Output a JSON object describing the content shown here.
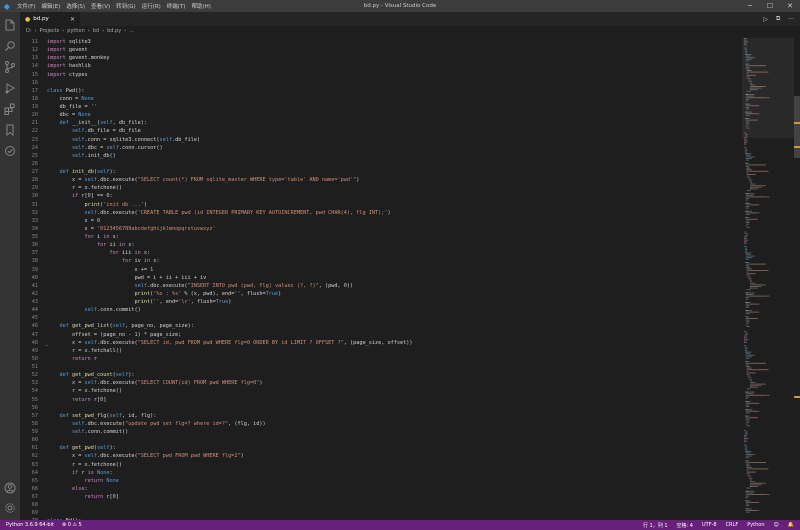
{
  "window": {
    "title": "bd.py - Visual Studio Code",
    "menu": [
      "文件(F)",
      "编辑(E)",
      "选择(S)",
      "查看(V)",
      "转到(G)",
      "运行(R)",
      "终端(T)",
      "帮助(H)"
    ],
    "controls": [
      "─",
      "☐",
      "✕"
    ]
  },
  "activity": [
    "explorer-icon",
    "search-icon",
    "source-control-icon",
    "run-debug-icon",
    "extensions-icon",
    "bookmark-icon",
    "testing-icon",
    "remote-icon",
    "account-icon",
    "gear-icon"
  ],
  "tab": {
    "label": "bd.py",
    "close": "✕"
  },
  "tab_actions": [
    "▷",
    "⧉",
    "···"
  ],
  "breadcrumb": [
    "D:",
    "Projects",
    "python",
    "bd",
    "bd.py",
    "..."
  ],
  "editor": {
    "marker_line": 48,
    "lines": [
      {
        "n": 11,
        "t": [
          [
            "kwc",
            "import"
          ],
          [
            "txt",
            " sqlite3"
          ]
        ]
      },
      {
        "n": 12,
        "t": [
          [
            "kwc",
            "import"
          ],
          [
            "txt",
            " gevent"
          ]
        ]
      },
      {
        "n": 13,
        "t": [
          [
            "kwc",
            "import"
          ],
          [
            "txt",
            " gevent.monkey"
          ]
        ]
      },
      {
        "n": 14,
        "t": [
          [
            "kwc",
            "import"
          ],
          [
            "txt",
            " hashlib"
          ]
        ]
      },
      {
        "n": 15,
        "t": [
          [
            "kwc",
            "import"
          ],
          [
            "txt",
            " ctypes"
          ]
        ]
      },
      {
        "n": 16,
        "t": []
      },
      {
        "n": 17,
        "t": [
          [
            "kw",
            "class"
          ],
          [
            "txt",
            " Pwd():"
          ]
        ]
      },
      {
        "n": 18,
        "t": [
          [
            "txt",
            "    conn = "
          ],
          [
            "kw",
            "None"
          ]
        ]
      },
      {
        "n": 19,
        "t": [
          [
            "txt",
            "    db_file = "
          ],
          [
            "str",
            "''"
          ]
        ]
      },
      {
        "n": 20,
        "t": [
          [
            "txt",
            "    dbc = "
          ],
          [
            "kw",
            "None"
          ]
        ]
      },
      {
        "n": 21,
        "t": [
          [
            "kw",
            "    def"
          ],
          [
            "fn",
            " __init__"
          ],
          [
            "txt",
            "("
          ],
          [
            "self",
            "self"
          ],
          [
            "txt",
            ", db_file):"
          ]
        ]
      },
      {
        "n": 22,
        "t": [
          [
            "self",
            "        self"
          ],
          [
            "txt",
            ".db_file = db_file"
          ]
        ]
      },
      {
        "n": 23,
        "t": [
          [
            "self",
            "        self"
          ],
          [
            "txt",
            ".conn = sqlite3.connect("
          ],
          [
            "self",
            "self"
          ],
          [
            "txt",
            ".db_file)"
          ]
        ]
      },
      {
        "n": 24,
        "t": [
          [
            "self",
            "        self"
          ],
          [
            "txt",
            ".dbc = "
          ],
          [
            "self",
            "self"
          ],
          [
            "txt",
            ".conn.cursor()"
          ]
        ]
      },
      {
        "n": 25,
        "t": [
          [
            "self",
            "        self"
          ],
          [
            "txt",
            ".init_db()"
          ]
        ]
      },
      {
        "n": 26,
        "t": []
      },
      {
        "n": 27,
        "t": [
          [
            "kw",
            "    def"
          ],
          [
            "fn",
            " init_db"
          ],
          [
            "txt",
            "("
          ],
          [
            "self",
            "self"
          ],
          [
            "txt",
            "):"
          ]
        ]
      },
      {
        "n": 28,
        "t": [
          [
            "txt",
            "        x = "
          ],
          [
            "self",
            "self"
          ],
          [
            "txt",
            ".dbc.execute("
          ],
          [
            "str",
            "\"SELECT count(*) FROM sqlite_master WHERE type='table' AND name='pwd'\""
          ],
          [
            "txt",
            ")"
          ]
        ]
      },
      {
        "n": 29,
        "t": [
          [
            "txt",
            "        r = x.fetchone()"
          ]
        ]
      },
      {
        "n": 30,
        "t": [
          [
            "kwc",
            "        if"
          ],
          [
            "txt",
            " r["
          ],
          [
            "num",
            "0"
          ],
          [
            "txt",
            "] == "
          ],
          [
            "num",
            "0"
          ],
          [
            "txt",
            ":"
          ]
        ]
      },
      {
        "n": 31,
        "t": [
          [
            "fn",
            "            print"
          ],
          [
            "txt",
            "("
          ],
          [
            "str",
            "'init db ...'"
          ],
          [
            "txt",
            ")"
          ]
        ]
      },
      {
        "n": 32,
        "t": [
          [
            "self",
            "            self"
          ],
          [
            "txt",
            ".dbc.execute("
          ],
          [
            "str",
            "'CREATE TABLE pwd (id INTEGER PRIMARY KEY AUTOINCREMENT, pwd CHAR(4), flg INT);'"
          ],
          [
            "txt",
            ")"
          ]
        ]
      },
      {
        "n": 33,
        "t": [
          [
            "txt",
            "            x = "
          ],
          [
            "num",
            "0"
          ]
        ]
      },
      {
        "n": 34,
        "t": [
          [
            "txt",
            "            s = "
          ],
          [
            "str",
            "'0123456789abcdefghijklmnopqrstuvwxyz'"
          ]
        ]
      },
      {
        "n": 35,
        "t": [
          [
            "kwc",
            "            for"
          ],
          [
            "txt",
            " i "
          ],
          [
            "kwc",
            "in"
          ],
          [
            "txt",
            " s:"
          ]
        ]
      },
      {
        "n": 36,
        "t": [
          [
            "kwc",
            "                for"
          ],
          [
            "txt",
            " ii "
          ],
          [
            "kwc",
            "in"
          ],
          [
            "txt",
            " s:"
          ]
        ]
      },
      {
        "n": 37,
        "t": [
          [
            "kwc",
            "                    for"
          ],
          [
            "txt",
            " iii "
          ],
          [
            "kwc",
            "in"
          ],
          [
            "txt",
            " s:"
          ]
        ]
      },
      {
        "n": 38,
        "t": [
          [
            "kwc",
            "                        for"
          ],
          [
            "txt",
            " iv "
          ],
          [
            "kwc",
            "in"
          ],
          [
            "txt",
            " s:"
          ]
        ]
      },
      {
        "n": 39,
        "t": [
          [
            "txt",
            "                            x += "
          ],
          [
            "num",
            "1"
          ]
        ]
      },
      {
        "n": 40,
        "t": [
          [
            "txt",
            "                            pwd = i + ii + iii + iv"
          ]
        ]
      },
      {
        "n": 41,
        "t": [
          [
            "self",
            "                            self"
          ],
          [
            "txt",
            ".dbc.execute("
          ],
          [
            "str",
            "\"INSERT INTO pwd (pwd, flg) values (?, ?)\""
          ],
          [
            "txt",
            ", (pwd, "
          ],
          [
            "num",
            "0"
          ],
          [
            "txt",
            "))"
          ]
        ]
      },
      {
        "n": 42,
        "t": [
          [
            "fn",
            "                            print"
          ],
          [
            "txt",
            "("
          ],
          [
            "str",
            "'%s : %s'"
          ],
          [
            "txt",
            " % (x, pwd), end="
          ],
          [
            "str",
            "''"
          ],
          [
            "txt",
            ", flush="
          ],
          [
            "kw",
            "True"
          ],
          [
            "txt",
            ")"
          ]
        ]
      },
      {
        "n": 43,
        "t": [
          [
            "fn",
            "                            print"
          ],
          [
            "txt",
            "("
          ],
          [
            "str",
            "''"
          ],
          [
            "txt",
            ", end="
          ],
          [
            "str",
            "'\\r'"
          ],
          [
            "txt",
            ", flush="
          ],
          [
            "kw",
            "True"
          ],
          [
            "txt",
            ")"
          ]
        ]
      },
      {
        "n": 44,
        "t": [
          [
            "self",
            "            self"
          ],
          [
            "txt",
            ".conn.commit()"
          ]
        ]
      },
      {
        "n": 45,
        "t": []
      },
      {
        "n": 46,
        "t": [
          [
            "kw",
            "    def"
          ],
          [
            "fn",
            " get_pwd_list"
          ],
          [
            "txt",
            "("
          ],
          [
            "self",
            "self"
          ],
          [
            "txt",
            ", page_no, page_size):"
          ]
        ]
      },
      {
        "n": 47,
        "t": [
          [
            "txt",
            "        offset = (page_no - "
          ],
          [
            "num",
            "1"
          ],
          [
            "txt",
            ") * page_size;"
          ]
        ]
      },
      {
        "n": 48,
        "t": [
          [
            "txt",
            "        x = "
          ],
          [
            "self",
            "self"
          ],
          [
            "txt",
            ".dbc.execute("
          ],
          [
            "str",
            "\"SELECT id, pwd FROM pwd WHERE flg=0 ORDER BY id LIMIT ? OFFSET ?\""
          ],
          [
            "txt",
            ", (page_size, offset))"
          ]
        ]
      },
      {
        "n": 49,
        "t": [
          [
            "txt",
            "        r = x.fetchall()"
          ]
        ]
      },
      {
        "n": 50,
        "t": [
          [
            "kwc",
            "        return"
          ],
          [
            "txt",
            " r"
          ]
        ]
      },
      {
        "n": 51,
        "t": []
      },
      {
        "n": 52,
        "t": [
          [
            "kw",
            "    def"
          ],
          [
            "fn",
            " get_pwd_count"
          ],
          [
            "txt",
            "("
          ],
          [
            "self",
            "self"
          ],
          [
            "txt",
            "):"
          ]
        ]
      },
      {
        "n": 53,
        "t": [
          [
            "txt",
            "        x = "
          ],
          [
            "self",
            "self"
          ],
          [
            "txt",
            ".dbc.execute("
          ],
          [
            "str",
            "\"SELECT COUNT(id) FROM pwd WHERE flg=0\""
          ],
          [
            "txt",
            ")"
          ]
        ]
      },
      {
        "n": 54,
        "t": [
          [
            "txt",
            "        r = x.fetchone()"
          ]
        ]
      },
      {
        "n": 55,
        "t": [
          [
            "kwc",
            "        return"
          ],
          [
            "txt",
            " r["
          ],
          [
            "num",
            "0"
          ],
          [
            "txt",
            "]"
          ]
        ]
      },
      {
        "n": 56,
        "t": []
      },
      {
        "n": 57,
        "t": [
          [
            "kw",
            "    def"
          ],
          [
            "fn",
            " set_pwd_flg"
          ],
          [
            "txt",
            "("
          ],
          [
            "self",
            "self"
          ],
          [
            "txt",
            ", id, flg):"
          ]
        ]
      },
      {
        "n": 58,
        "t": [
          [
            "self",
            "        self"
          ],
          [
            "txt",
            ".dbc.execute("
          ],
          [
            "str",
            "\"update pwd set flg=? where id=?\""
          ],
          [
            "txt",
            ", (flg, id))"
          ]
        ]
      },
      {
        "n": 59,
        "t": [
          [
            "self",
            "        self"
          ],
          [
            "txt",
            ".conn.commit()"
          ]
        ]
      },
      {
        "n": 60,
        "t": []
      },
      {
        "n": 61,
        "t": [
          [
            "kw",
            "    def"
          ],
          [
            "fn",
            " get_pwd"
          ],
          [
            "txt",
            "("
          ],
          [
            "self",
            "self"
          ],
          [
            "txt",
            "):"
          ]
        ]
      },
      {
        "n": 62,
        "t": [
          [
            "txt",
            "        x = "
          ],
          [
            "self",
            "self"
          ],
          [
            "txt",
            ".dbc.execute("
          ],
          [
            "str",
            "\"SELECT pwd FROM pwd WHERE flg=2\""
          ],
          [
            "txt",
            ")"
          ]
        ]
      },
      {
        "n": 63,
        "t": [
          [
            "txt",
            "        r = x.fetchone()"
          ]
        ]
      },
      {
        "n": 64,
        "t": [
          [
            "kwc",
            "        if"
          ],
          [
            "txt",
            " r "
          ],
          [
            "kwc",
            "is"
          ],
          [
            "kw",
            " None"
          ],
          [
            "txt",
            ":"
          ]
        ]
      },
      {
        "n": 65,
        "t": [
          [
            "kwc",
            "            return"
          ],
          [
            "kw",
            " None"
          ]
        ]
      },
      {
        "n": 66,
        "t": [
          [
            "kwc",
            "        else"
          ],
          [
            "txt",
            ":"
          ]
        ]
      },
      {
        "n": 67,
        "t": [
          [
            "kwc",
            "            return"
          ],
          [
            "txt",
            " r["
          ],
          [
            "num",
            "0"
          ],
          [
            "txt",
            "]"
          ]
        ]
      },
      {
        "n": 68,
        "t": []
      },
      {
        "n": 69,
        "t": []
      },
      {
        "n": 70,
        "t": [
          [
            "kw",
            "class"
          ],
          [
            "txt",
            " Bd():"
          ]
        ]
      },
      {
        "n": 71,
        "t": [
          [
            "txt",
            "    cookies = "
          ],
          [
            "kw",
            "None"
          ]
        ]
      },
      {
        "n": 72,
        "t": [
          [
            "txt",
            "    headers = "
          ],
          [
            "kw",
            "None"
          ]
        ]
      }
    ]
  },
  "status": {
    "left": [
      "Python 3.6.9 64-bit",
      "⊗ 0  ⚠ 5"
    ],
    "right": [
      "行 1，列 1",
      "空格: 4",
      "UTF-8",
      "CRLF",
      "Python",
      "☺",
      "🔔"
    ]
  },
  "colors": {
    "statusbar": "#68217a",
    "activitybar": "#333333",
    "editor": "#1e1e1e",
    "titlebar": "#3c3c3c"
  }
}
